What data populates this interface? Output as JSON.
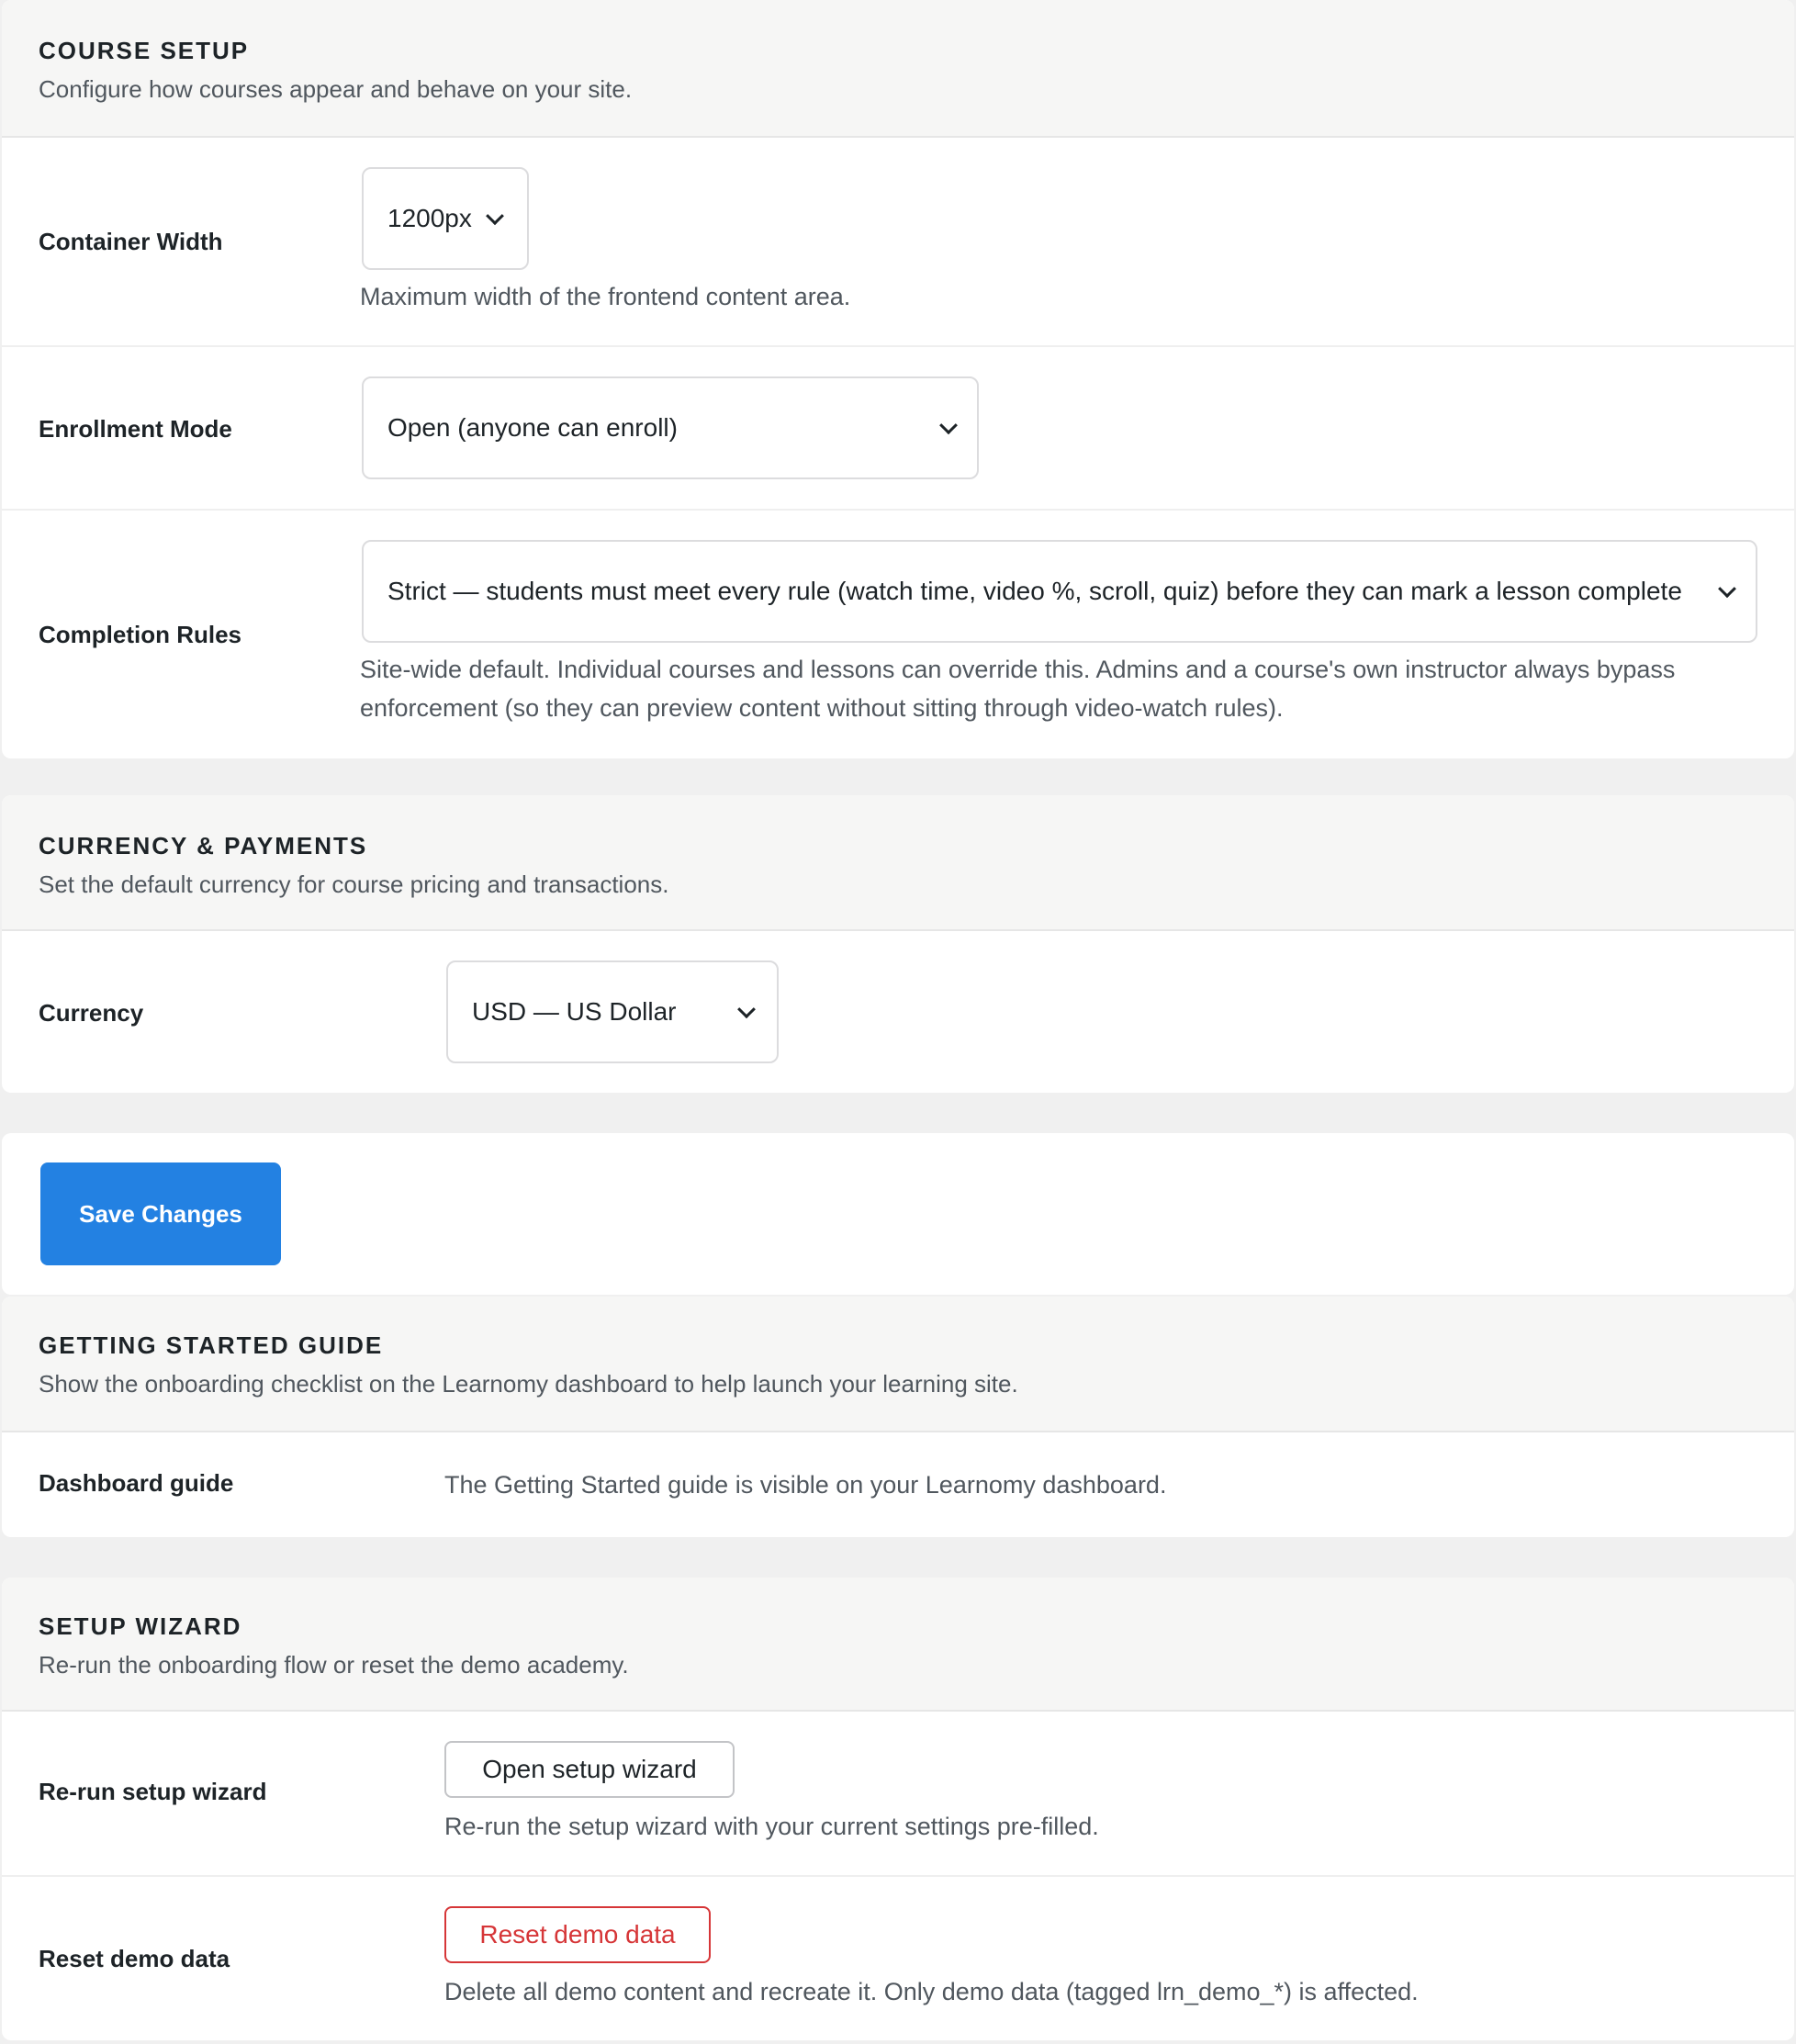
{
  "course_setup": {
    "title": "COURSE SETUP",
    "description": "Configure how courses appear and behave on your site.",
    "container_width": {
      "label": "Container Width",
      "value": "1200px",
      "help": "Maximum width of the frontend content area."
    },
    "enrollment_mode": {
      "label": "Enrollment Mode",
      "value": "Open (anyone can enroll)"
    },
    "completion_rules": {
      "label": "Completion Rules",
      "value": "Strict — students must meet every rule (watch time, video %, scroll, quiz) before they can mark a lesson complete",
      "help": "Site-wide default. Individual courses and lessons can override this. Admins and a course's own instructor always bypass enforcement (so they can preview content without sitting through video-watch rules)."
    }
  },
  "currency_payments": {
    "title": "CURRENCY & PAYMENTS",
    "description": "Set the default currency for course pricing and transactions.",
    "currency": {
      "label": "Currency",
      "value": "USD — US Dollar"
    }
  },
  "actions": {
    "save_label": "Save Changes"
  },
  "getting_started": {
    "title": "GETTING STARTED GUIDE",
    "description": "Show the onboarding checklist on the Learnomy dashboard to help launch your learning site.",
    "dashboard_guide": {
      "label": "Dashboard guide",
      "status": "The Getting Started guide is visible on your Learnomy dashboard."
    }
  },
  "setup_wizard": {
    "title": "SETUP WIZARD",
    "description": "Re-run the onboarding flow or reset the demo academy.",
    "rerun": {
      "label": "Re-run setup wizard",
      "button": "Open setup wizard",
      "help": "Re-run the setup wizard with your current settings pre-filled."
    },
    "reset": {
      "label": "Reset demo data",
      "button": "Reset demo data",
      "help": "Delete all demo content and recreate it. Only demo data (tagged lrn_demo_*) is affected."
    }
  },
  "colors": {
    "primary": "#2381e2",
    "danger": "#d63638",
    "page_bg": "#f0f0f0",
    "card_header_bg": "#f6f6f5"
  },
  "icons": {
    "select_arrow": "chevron-down-icon"
  }
}
